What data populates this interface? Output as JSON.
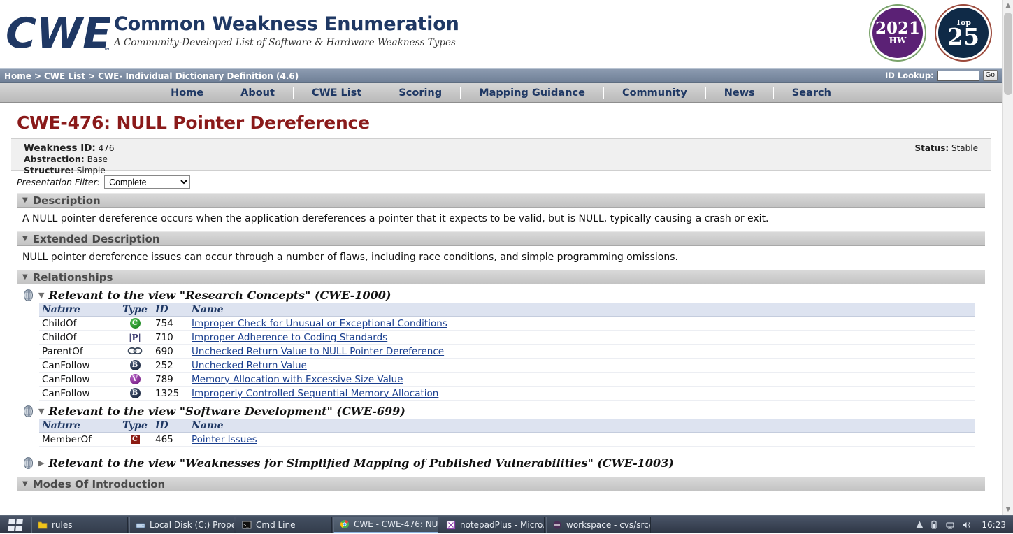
{
  "site": {
    "brand_title": "Common Weakness Enumeration",
    "brand_subtitle": "A Community-Developed List of Software & Hardware Weakness Types",
    "logo_text": "CWE",
    "badges": [
      {
        "name": "hw-2021-badge",
        "top": "",
        "big": "2021",
        "small": "HW",
        "color": "#5b2175"
      },
      {
        "name": "top25-badge",
        "top": "Top",
        "big": "25",
        "small": "",
        "color": "#0f2a47"
      }
    ]
  },
  "breadcrumb": {
    "home": "Home",
    "sep1": ">",
    "cwe_list": "CWE List",
    "sep2": ">",
    "current": "CWE- Individual Dictionary Definition (4.6)"
  },
  "id_lookup": {
    "label": "ID Lookup:",
    "value": "",
    "placeholder": "",
    "go_label": "Go"
  },
  "nav": {
    "items": [
      {
        "label": "Home"
      },
      {
        "label": "About"
      },
      {
        "label": "CWE List"
      },
      {
        "label": "Scoring"
      },
      {
        "label": "Mapping Guidance"
      },
      {
        "label": "Community"
      },
      {
        "label": "News"
      },
      {
        "label": "Search"
      }
    ]
  },
  "page": {
    "title": "CWE-476: NULL Pointer Dereference",
    "weakness_id_label": "Weakness ID:",
    "weakness_id_value": "476",
    "abstraction_label": "Abstraction:",
    "abstraction_value": "Base",
    "structure_label": "Structure:",
    "structure_value": "Simple",
    "status_label": "Status:",
    "status_value": "Stable"
  },
  "presentation_filter": {
    "label": "Presentation Filter:",
    "selected": "Complete",
    "options": [
      "Complete"
    ]
  },
  "sections": {
    "description": {
      "heading": "Description",
      "chevron": "▼",
      "body": "A NULL pointer dereference occurs when the application dereferences a pointer that it expects to be valid, but is NULL, typically causing a crash or exit."
    },
    "extended_description": {
      "heading": "Extended Description",
      "chevron": "▼",
      "body": "NULL pointer dereference issues can occur through a number of flaws, including race conditions, and simple programming omissions."
    },
    "relationships": {
      "heading": "Relationships",
      "chevron": "▼"
    },
    "modes_of_introduction": {
      "heading": "Modes Of Introduction",
      "chevron": "▼"
    }
  },
  "relationship_views": [
    {
      "title": "Relevant to the view \"Research Concepts\" (CWE-1000)",
      "chevron": "▼",
      "expanded": true,
      "columns": [
        "Nature",
        "Type",
        "ID",
        "Name"
      ],
      "rows": [
        {
          "nature": "ChildOf",
          "type_icon": "class-icon",
          "type_letter": "C",
          "id": "754",
          "name": "Improper Check for Unusual or Exceptional Conditions"
        },
        {
          "nature": "ChildOf",
          "type_icon": "pillar-icon",
          "type_letter": "|P|",
          "id": "710",
          "name": "Improper Adherence to Coding Standards"
        },
        {
          "nature": "ParentOf",
          "type_icon": "compound-icon",
          "type_letter": "∞",
          "id": "690",
          "name": "Unchecked Return Value to NULL Pointer Dereference"
        },
        {
          "nature": "CanFollow",
          "type_icon": "base-icon",
          "type_letter": "B",
          "id": "252",
          "name": "Unchecked Return Value"
        },
        {
          "nature": "CanFollow",
          "type_icon": "variant-icon",
          "type_letter": "V",
          "id": "789",
          "name": "Memory Allocation with Excessive Size Value"
        },
        {
          "nature": "CanFollow",
          "type_icon": "base-icon",
          "type_letter": "B",
          "id": "1325",
          "name": "Improperly Controlled Sequential Memory Allocation"
        }
      ]
    },
    {
      "title": "Relevant to the view \"Software Development\" (CWE-699)",
      "chevron": "▼",
      "expanded": true,
      "columns": [
        "Nature",
        "Type",
        "ID",
        "Name"
      ],
      "rows": [
        {
          "nature": "MemberOf",
          "type_icon": "category-icon",
          "type_letter": "C",
          "id": "465",
          "name": "Pointer Issues"
        }
      ]
    },
    {
      "title": "Relevant to the view \"Weaknesses for Simplified Mapping of Published Vulnerabilities\" (CWE-1003)",
      "chevron": "▶",
      "expanded": false,
      "columns": [],
      "rows": []
    }
  ],
  "taskbar": {
    "start_label": "Start",
    "items": [
      {
        "label": "rules",
        "icon": "folder-icon",
        "active": false
      },
      {
        "label": "Local Disk (C:) Prope...",
        "icon": "drive-icon",
        "active": false
      },
      {
        "label": "Cmd Line",
        "icon": "console-icon",
        "active": false
      },
      {
        "label": "CWE - CWE-476: NU...",
        "icon": "chrome-icon",
        "active": true
      },
      {
        "label": "notepadPlus - Micro...",
        "icon": "notepad-icon",
        "active": false
      },
      {
        "label": "workspace - cvs/src/...",
        "icon": "eclipse-icon",
        "active": false
      }
    ],
    "tray": {
      "show_hidden": "▲",
      "battery": "battery-icon",
      "network": "network-icon",
      "volume": "volume-icon",
      "clock": "16:23"
    }
  }
}
